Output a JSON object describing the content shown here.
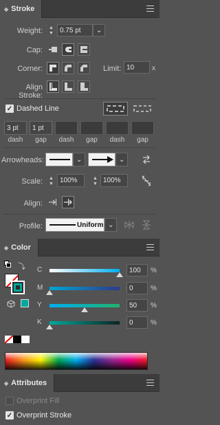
{
  "stroke": {
    "tab": "Stroke",
    "weight": {
      "label": "Weight:",
      "value": "0.75 pt"
    },
    "cap_label": "Cap:",
    "corner_label": "Corner:",
    "limit": {
      "label": "Limit:",
      "value": "10",
      "unit": "x"
    },
    "align_label": "Align Stroke:",
    "dashed": {
      "label": "Dashed Line",
      "checked": true
    },
    "dash_values": [
      "3 pt",
      "1 pt",
      "",
      "",
      "",
      ""
    ],
    "dash_labels": [
      "dash",
      "gap",
      "dash",
      "gap",
      "dash",
      "gap"
    ],
    "arrowheads_label": "Arrowheads:",
    "scale": {
      "label": "Scale:",
      "start": "100%",
      "end": "100%"
    },
    "align_label2": "Align:",
    "profile": {
      "label": "Profile:",
      "value": "Uniform"
    }
  },
  "color": {
    "tab": "Color",
    "channels": [
      {
        "name": "C",
        "value": "100",
        "unit": "%",
        "level": 1.0
      },
      {
        "name": "M",
        "value": "0",
        "unit": "%",
        "level": 0.0
      },
      {
        "name": "Y",
        "value": "50",
        "unit": "%",
        "level": 0.5
      },
      {
        "name": "K",
        "value": "0",
        "unit": "%",
        "level": 0.0
      }
    ],
    "fill_color": "#ffffff",
    "stroke_color": "#00a99d"
  },
  "attributes": {
    "tab": "Attributes",
    "overprint_fill": {
      "label": "Overprint Fill",
      "checked": false
    },
    "overprint_stroke": {
      "label": "Overprint Stroke",
      "checked": true
    }
  }
}
